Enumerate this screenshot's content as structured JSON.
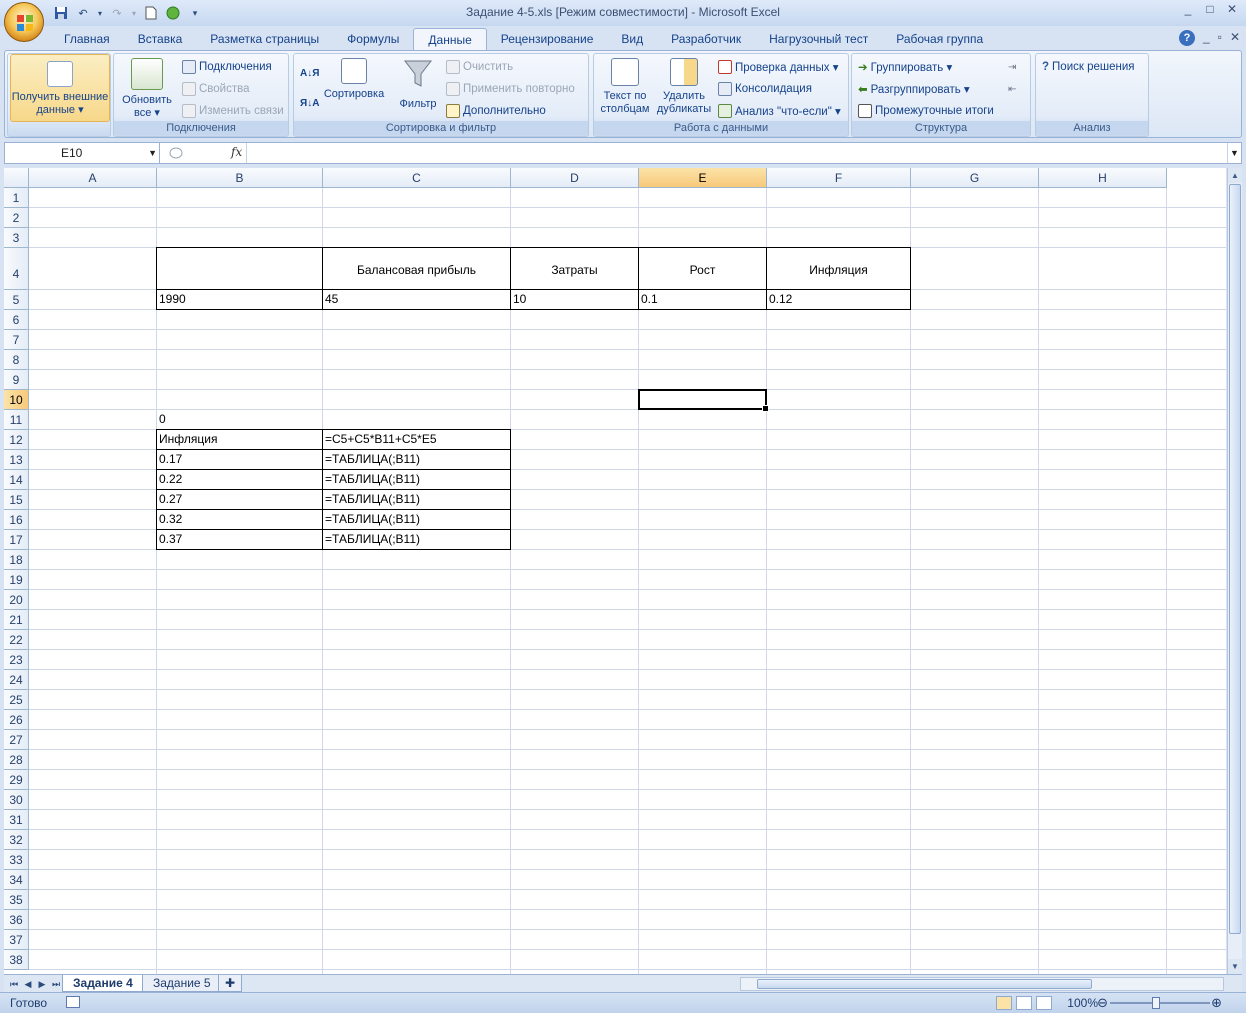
{
  "window": {
    "title": "Задание 4-5.xls  [Режим совместимости] - Microsoft Excel",
    "controls": [
      "_",
      "□",
      "✕"
    ]
  },
  "ribbon_tabs": [
    "Главная",
    "Вставка",
    "Разметка страницы",
    "Формулы",
    "Данные",
    "Рецензирование",
    "Вид",
    "Разработчик",
    "Нагрузочный тест",
    "Рабочая группа"
  ],
  "active_tab": "Данные",
  "ribbon": {
    "get_external": "Получить внешние данные ▾",
    "refresh_all": "Обновить все ▾",
    "connections": "Подключения",
    "properties": "Свойства",
    "edit_links": "Изменить связи",
    "group_connections": "Подключения",
    "sort": "Сортировка",
    "filter": "Фильтр",
    "clear": "Очистить",
    "reapply": "Применить повторно",
    "advanced": "Дополнительно",
    "group_sort_filter": "Сортировка и фильтр",
    "text_to_columns": "Текст по столбцам",
    "remove_duplicates": "Удалить дубликаты",
    "data_validation": "Проверка данных ▾",
    "consolidate": "Консолидация",
    "what_if": "Анализ \"что-если\" ▾",
    "group_data_tools": "Работа с данными",
    "group_btn": "Группировать ▾",
    "ungroup_btn": "Разгруппировать ▾",
    "subtotals": "Промежуточные итоги",
    "group_outline": "Структура",
    "solver": "Поиск решения",
    "group_analysis": "Анализ"
  },
  "formula_bar": {
    "name_box": "E10",
    "fx": "fx",
    "formula": ""
  },
  "columns": [
    "A",
    "B",
    "C",
    "D",
    "E",
    "F",
    "G",
    "H"
  ],
  "selected_column": "E",
  "rows": [
    "1",
    "2",
    "3",
    "4",
    "5",
    "6",
    "7",
    "8",
    "9",
    "10",
    "11",
    "12",
    "13",
    "14",
    "15",
    "16",
    "17",
    "18",
    "19",
    "20",
    "21",
    "22",
    "23",
    "24",
    "25",
    "26",
    "27",
    "28",
    "29",
    "30",
    "31",
    "32",
    "33",
    "34",
    "35",
    "36",
    "37",
    "38"
  ],
  "selected_row": "10",
  "cells": {
    "C4": "Балансовая прибыль",
    "D4": "Затраты",
    "E4": "Рост",
    "F4": "Инфляция",
    "B5": "1990",
    "C5": "45",
    "D5": "10",
    "E5": "0.1",
    "F5": "0.12",
    "B11": "0",
    "B12": "Инфляция",
    "C12": "=C5+C5*B11+C5*E5",
    "B13": "0.17",
    "C13": "=ТАБЛИЦА(;B11)",
    "B14": "0.22",
    "C14": "=ТАБЛИЦА(;B11)",
    "B15": "0.27",
    "C15": "=ТАБЛИЦА(;B11)",
    "B16": "0.32",
    "C16": "=ТАБЛИЦА(;B11)",
    "B17": "0.37",
    "C17": "=ТАБЛИЦА(;B11)"
  },
  "sheets": [
    "Задание 4",
    "Задание 5"
  ],
  "active_sheet": "Задание 4",
  "status": {
    "ready": "Готово",
    "zoom": "100%"
  }
}
